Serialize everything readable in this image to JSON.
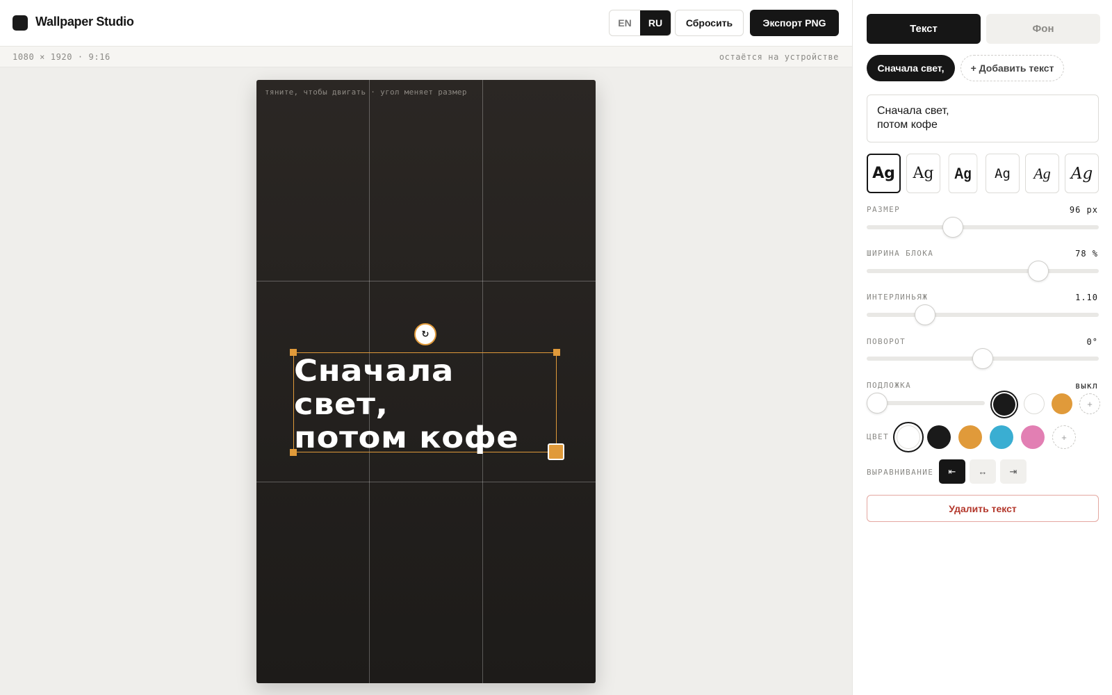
{
  "app": {
    "title": "Wallpaper Studio"
  },
  "header": {
    "languages": [
      {
        "label": "EN",
        "active": false
      },
      {
        "label": "RU",
        "active": true
      }
    ],
    "reset_label": "Сбросить",
    "export_label": "Экспорт PNG"
  },
  "subbar": {
    "dimensions": "1080 × 1920 · 9:16",
    "privacy_note": "остаётся на устройстве"
  },
  "canvas": {
    "hint": "тяните, чтобы двигать · угол меняет размер",
    "text": "Сначала\nсвет,\nпотом кофе",
    "rotate_icon": "↻",
    "background_colors": [
      "#2b2724",
      "#1d1b19"
    ],
    "selection_color": "#e09a3a"
  },
  "panel": {
    "tabs": [
      {
        "label": "Текст",
        "active": true
      },
      {
        "label": "Фон",
        "active": false
      }
    ],
    "layers": {
      "active_label": "Сначала свет,",
      "add_label": "+ Добавить текст"
    },
    "text_value": "Сначала свет,\nпотом кофе",
    "font_sample": "Ag",
    "size": {
      "label": "РАЗМЕР",
      "value": "96 px",
      "position": 0.37
    },
    "block_width": {
      "label": "ШИРИНА БЛОКА",
      "value": "78 %",
      "position": 0.74
    },
    "line_height": {
      "label": "ИНТЕРЛИНЬЯЖ",
      "value": "1.10",
      "position": 0.25
    },
    "rotation": {
      "label": "ПОВОРОТ",
      "value": "0°",
      "position": 0.5
    },
    "backing": {
      "label": "ПОДЛОЖКА",
      "value": "выкл",
      "position": 0.0,
      "swatches": [
        "#1a1a1a",
        "#ffffff",
        "#e09a3a"
      ],
      "add_icon": "+"
    },
    "color": {
      "label": "ЦВЕТ",
      "swatches": [
        "#ffffff",
        "#1a1a1a",
        "#e09a3a",
        "#3aaed2",
        "#e27fb3"
      ],
      "add_icon": "+"
    },
    "alignment": {
      "label": "ВЫРАВНИВАНИЕ",
      "options": [
        {
          "icon": "⇤",
          "active": true
        },
        {
          "icon": "↔",
          "active": false
        },
        {
          "icon": "⇥",
          "active": false
        }
      ]
    },
    "delete_label": "Удалить текст"
  }
}
